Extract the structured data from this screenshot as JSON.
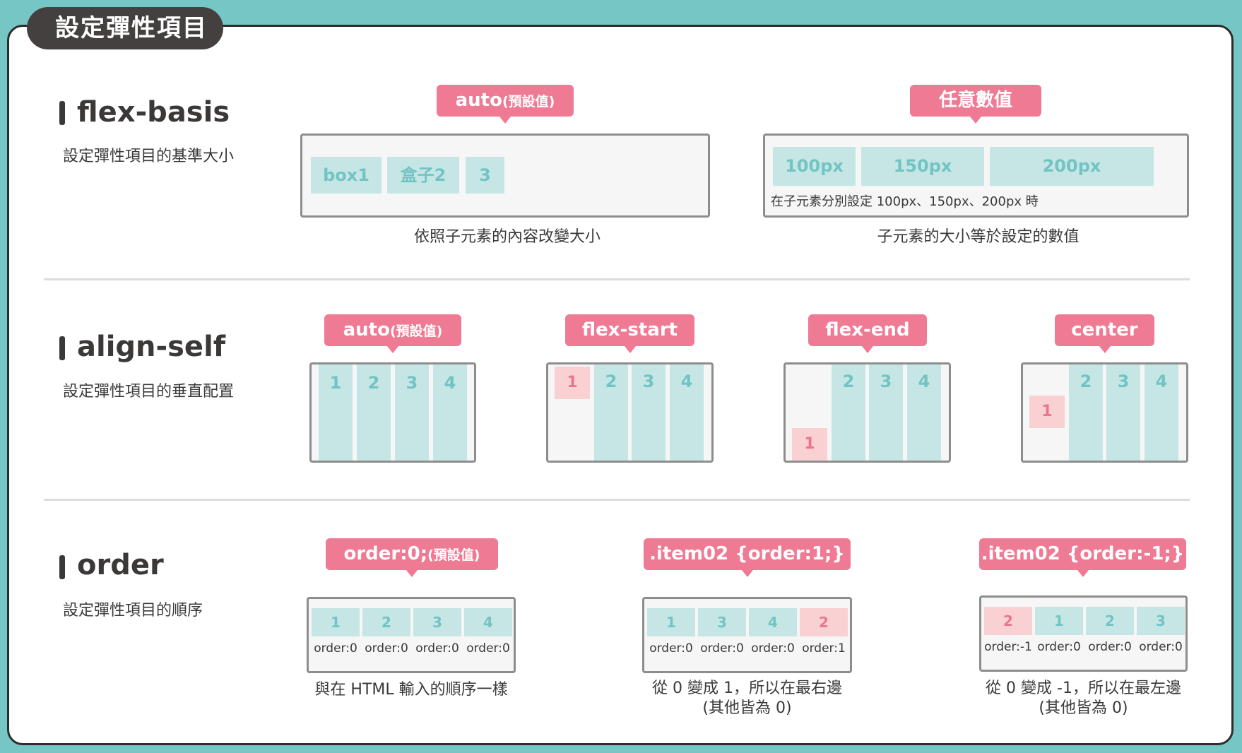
{
  "page_title": "設定彈性項目",
  "colors": {
    "accent": "#ef7a93",
    "teal_box": "#c6e6e6",
    "pink_box": "#f9d1d2",
    "background": "#75c6c4",
    "dark": "#454040"
  },
  "sections": {
    "flex_basis": {
      "title": "flex-basis",
      "desc": "設定彈性項目的基準大小",
      "auto_example": {
        "label": "auto",
        "label_note": "(預設值)",
        "boxes": [
          "box1",
          "盒子2",
          "3"
        ],
        "caption": "依照子元素的內容改變大小"
      },
      "value_example": {
        "label": "任意數值",
        "boxes": [
          "100px",
          "150px",
          "200px"
        ],
        "note": "在子元素分別設定 100px、150px、200px 時",
        "caption": "子元素的大小等於設定的數值"
      }
    },
    "align_self": {
      "title": "align-self",
      "desc": "設定彈性項目的垂直配置",
      "examples": [
        {
          "label": "auto",
          "label_note": "(預設值)",
          "boxes": [
            "1",
            "2",
            "3",
            "4"
          ]
        },
        {
          "label": "flex-start",
          "boxes": [
            "1",
            "2",
            "3",
            "4"
          ]
        },
        {
          "label": "flex-end",
          "boxes": [
            "1",
            "2",
            "3",
            "4"
          ]
        },
        {
          "label": "center",
          "boxes": [
            "1",
            "2",
            "3",
            "4"
          ]
        }
      ]
    },
    "order": {
      "title": "order",
      "desc": "設定彈性項目的順序",
      "examples": [
        {
          "label": "order:0;",
          "label_note": "(預設值)",
          "boxes": [
            "1",
            "2",
            "3",
            "4"
          ],
          "orders": [
            "order:0",
            "order:0",
            "order:0",
            "order:0"
          ],
          "caption": "與在 HTML 輸入的順序一樣"
        },
        {
          "label": ".item02 {order:1;}",
          "boxes": [
            "1",
            "3",
            "4",
            "2"
          ],
          "orders": [
            "order:0",
            "order:0",
            "order:0",
            "order:1"
          ],
          "caption_line1": "從 0 變成 1，所以在最右邊",
          "caption_line2": "(其他皆為 0)"
        },
        {
          "label": ".item02 {order:-1;}",
          "boxes": [
            "2",
            "1",
            "2",
            "3"
          ],
          "orders": [
            "order:-1",
            "order:0",
            "order:0",
            "order:0"
          ],
          "caption_line1": "從 0 變成 -1，所以在最左邊",
          "caption_line2": "(其他皆為 0)"
        }
      ]
    }
  }
}
